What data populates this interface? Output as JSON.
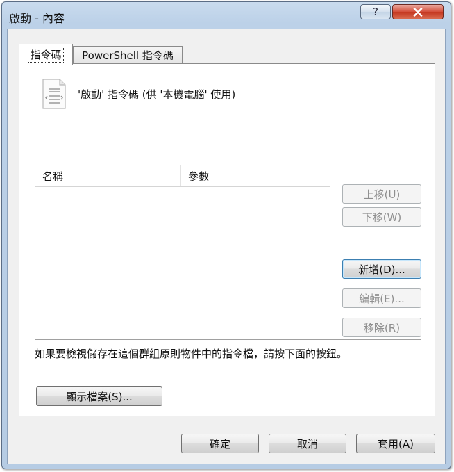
{
  "window": {
    "title": "啟動 - 內容",
    "help_label": "?",
    "close_label": "✕"
  },
  "tabs": [
    {
      "label": "指令碼",
      "active": true
    },
    {
      "label": "PowerShell 指令碼",
      "active": false
    }
  ],
  "panel": {
    "heading": "'啟動' 指令碼 (供 '本機電腦' 使用)",
    "list": {
      "columns": [
        "名稱",
        "參數"
      ],
      "rows": []
    },
    "buttons": {
      "up": "上移(U)",
      "down": "下移(W)",
      "add": "新增(D)...",
      "edit": "編輯(E)...",
      "remove": "移除(R)"
    },
    "info_text": "如果要檢視儲存在這個群組原則物件中的指令檔，請按下面的按鈕。",
    "show_files": "顯示檔案(S)..."
  },
  "footer": {
    "ok": "確定",
    "cancel": "取消",
    "apply": "套用(A)"
  },
  "colors": {
    "title_bar": "#bcd1e8",
    "close_button": "#c4361f",
    "dialog_background": "#f0f0f0"
  }
}
